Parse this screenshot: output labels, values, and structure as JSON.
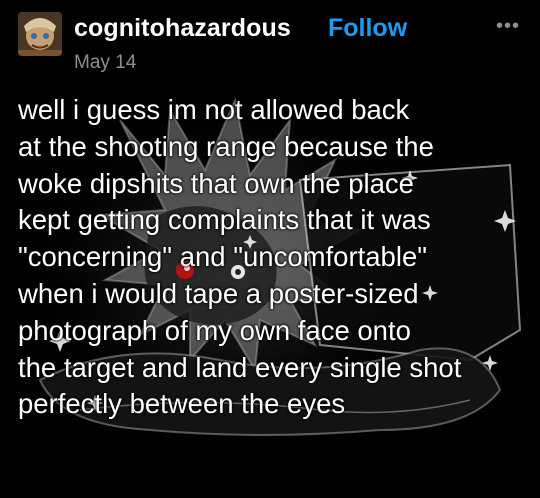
{
  "post": {
    "username": "cognitohazardous",
    "follow_label": "Follow",
    "date": "May 14",
    "more_label": "•••",
    "lines": [
      "well i guess im not allowed back",
      "at the shooting range because the",
      "woke dipshits that own the place",
      "kept getting complaints that it was",
      "\"concerning\" and \"uncomfortable\"",
      "when i would tape a poster-sized",
      "photograph of my own face onto",
      "the target and land every single shot",
      "perfectly between the eyes"
    ]
  },
  "icons": {
    "avatar": "avatar-image",
    "more": "more-options-icon",
    "background": "cartoon-artwork"
  },
  "colors": {
    "background": "#000000",
    "text": "#ffffff",
    "follow": "#1d9bf0",
    "muted": "#8e8e8e"
  }
}
